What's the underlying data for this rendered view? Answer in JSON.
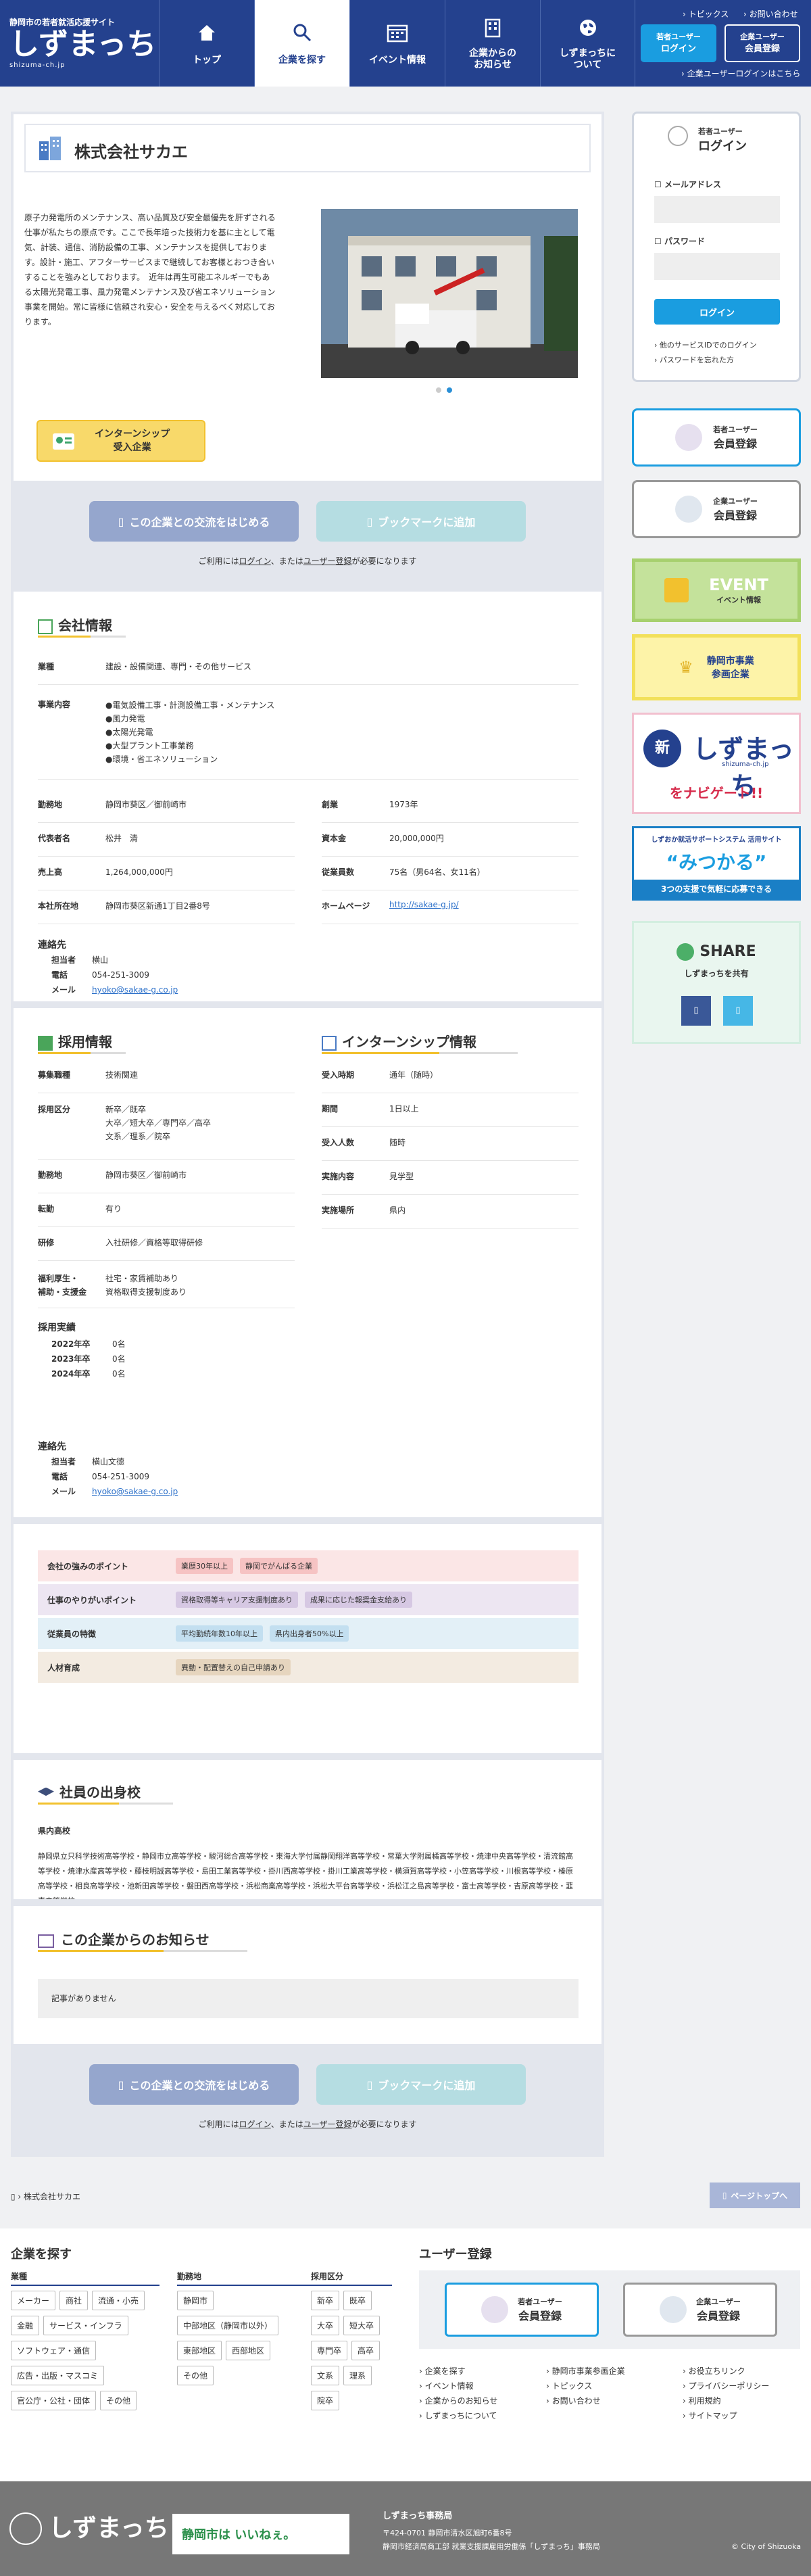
{
  "header": {
    "subtitle": "静岡市の若者就活応援サイト",
    "logo": "しずまっち",
    "logo_roman": "shizuma-ch.jp",
    "nav": [
      "トップ",
      "企業を探す",
      "イベント情報",
      "企業からの\nお知らせ",
      "しずまっちに\nついて"
    ],
    "top_links": [
      "トピックス",
      "お問い合わせ"
    ],
    "youth_login": "若者ユーザー",
    "youth_login2": "ログイン",
    "corp_reg": "企業ユーザー",
    "corp_reg2": "会員登録",
    "corp_login": "企業ユーザーログインはこちら"
  },
  "company": {
    "name": "株式会社サカエ",
    "description": "原子力発電所のメンテナンス、高い品質及び安全最優先を肝ずされる仕事が私たちの原点です。ここで長年培った技術力を基に主として電気、計装、通信、消防設備の工事、メンテナンスを提供しております。設計・施工、アフターサービスまで継続してお客様とおつき合いすることを強みとしております。　近年は再生可能エネルギーでもある太陽光発電工事、風力発電メンテナンス及び省エネソリューション事業を開始。常に皆様に信頼され安心・安全を与えるべく対応しております。",
    "badge": "インターンシップ\n受入企業",
    "btn_exchange": "この企業との交流をはじめる",
    "btn_bookmark": "ブックマークに追加",
    "note_pre": "ご利用には",
    "note_login": "ログイン",
    "note_mid": "、または",
    "note_reg": "ユーザー登録",
    "note_post": "が必要になります"
  },
  "info": {
    "title": "会社情報",
    "industry_k": "業種",
    "industry_v": "建設・設備関連、専門・その他サービス",
    "business_k": "事業内容",
    "business_v": [
      "●電気設備工事・計測設備工事・メンテナンス",
      "●風力発電",
      "●太陽光発電",
      "●大型プラント工事業務",
      "●環境・省エネソリューション"
    ],
    "rows": [
      [
        "勤務地",
        "静岡市葵区／御前崎市",
        "創業",
        "1973年"
      ],
      [
        "代表者名",
        "松井　清",
        "資本金",
        "20,000,000円"
      ],
      [
        "売上高",
        "1,264,000,000円",
        "従業員数",
        "75名（男64名、女11名）"
      ],
      [
        "本社所在地",
        "静岡市葵区新通1丁目2番8号",
        "ホームページ",
        "http://sakae-g.jp/"
      ]
    ],
    "contact_title": "連絡先",
    "contact": [
      [
        "担当者",
        "横山"
      ],
      [
        "電話",
        "054-251-3009"
      ],
      [
        "メール",
        "hyoko@sakae-g.co.jp"
      ]
    ]
  },
  "recruit": {
    "title": "採用情報",
    "rows": [
      [
        "募集職種",
        "技術関連"
      ],
      [
        "採用区分",
        "新卒／既卒\n大卒／短大卒／専門卒／高卒\n文系／理系／院卒"
      ],
      [
        "勤務地",
        "静岡市葵区／御前崎市"
      ],
      [
        "転勤",
        "有り"
      ],
      [
        "研修",
        "入社研修／資格等取得研修"
      ],
      [
        "福利厚生・\n補助・支援金",
        "社宅・家賃補助あり\n資格取得支援制度あり"
      ]
    ],
    "results_title": "採用実績",
    "results": [
      [
        "2022年卒",
        "0名"
      ],
      [
        "2023年卒",
        "0名"
      ],
      [
        "2024年卒",
        "0名"
      ]
    ],
    "contact_title": "連絡先",
    "contact": [
      [
        "担当者",
        "横山文德"
      ],
      [
        "電話",
        "054-251-3009"
      ],
      [
        "メール",
        "hyoko@sakae-g.co.jp"
      ]
    ]
  },
  "intern": {
    "title": "インターンシップ情報",
    "rows": [
      [
        "受入時期",
        "通年（随時）"
      ],
      [
        "期間",
        "1日以上"
      ],
      [
        "受入人数",
        "随時"
      ],
      [
        "実施内容",
        "見学型"
      ],
      [
        "実施場所",
        "県内"
      ]
    ]
  },
  "points": [
    {
      "k": "会社の強みのポイント",
      "tags": [
        "業歴30年以上",
        "静岡でがんばる企業"
      ],
      "bg": "#fbe6e6",
      "tc": "#f6c3c3"
    },
    {
      "k": "仕事のやりがいポイント",
      "tags": [
        "資格取得等キャリア支援制度あり",
        "成果に応じた報奨金支給あり"
      ],
      "bg": "#ede6f2",
      "tc": "#d6c8e3"
    },
    {
      "k": "従業員の特徴",
      "tags": [
        "平均勤続年数10年以上",
        "県内出身者50%以上"
      ],
      "bg": "#e3f0f7",
      "tc": "#c3dff0"
    },
    {
      "k": "人材育成",
      "tags": [
        "異動・配置替えの自己申請あり"
      ],
      "bg": "#f3ebe1",
      "tc": "#e6d5be"
    }
  ],
  "schools": {
    "title": "社員の出身校",
    "sub": "県内高校",
    "text": "静岡県立只科学技術高等学校・静岡市立高等学校・駿河総合高等学校・東海大学付属静岡翔洋高等学校・常葉大学附属橘高等学校・焼津中央高等学校・清流館高等学校・焼津水産高等学校・藤枝明誠高等学校・島田工業高等学校・掛川西高等学校・掛川工業高等学校・横須賀高等学校・小笠高等学校・川根高等学校・榛原高等学校・相良高等学校・池新田高等学校・磐田西高等学校・浜松商業高等学校・浜松大平台高等学校・浜松江之島高等学校・富士高等学校・吉原高等学校・韮恵高等学校"
  },
  "notice": {
    "title": "この企業からのお知らせ",
    "empty": "記事がありません"
  },
  "breadcrumb": "株式会社サカエ",
  "pagetop": "ページトップへ",
  "side": {
    "login_title": "若者ユーザー",
    "login_title2": "ログイン",
    "mail": "メールアドレス",
    "pass": "パスワード",
    "login_btn": "ログイン",
    "other": "他のサービスIDでのログイン",
    "forgot": "パスワードを忘れた方",
    "youth_reg": "若者ユーザー",
    "youth_reg2": "会員登録",
    "corp_reg": "企業ユーザー",
    "corp_reg2": "会員登録",
    "event": "EVENT",
    "event_sub": "イベント情報",
    "city": "静岡市事業\n参画企業",
    "navi_logo": "しずまっち",
    "navi_sub": "shizuma-ch.jp",
    "navi": "をナビゲート!!",
    "support": "しずおか就活サポートシステム 活用サイト",
    "mitsukaru": "“みつかる”",
    "mitsukaru_sub": "3つの支援で気軽に応募できる",
    "share": "SHARE",
    "share_sub": "しずまっちを共有"
  },
  "footer": {
    "search_title": "企業を探す",
    "industry": "業種",
    "ind_items": [
      "メーカー",
      "商社",
      "流通・小売",
      "金融",
      "サービス・インフラ",
      "ソフトウェア・通信",
      "広告・出版・マスコミ",
      "官公庁・公社・団体",
      "その他"
    ],
    "location": "勤務地",
    "loc_items": [
      "静岡市",
      "中部地区（静岡市以外）",
      "東部地区",
      "西部地区",
      "その他"
    ],
    "kubun": "採用区分",
    "kubun_items": [
      "新卒",
      "既卒",
      "大卒",
      "短大卒",
      "専門卒",
      "高卒",
      "文系",
      "理系",
      "院卒"
    ],
    "reg_title": "ユーザー登録",
    "youth": "若者ユーザー",
    "youth2": "会員登録",
    "corp": "企業ユーザー",
    "corp2": "会員登録",
    "links1": [
      "企業を探す",
      "イベント情報",
      "企業からのお知らせ",
      "しずまっちについて"
    ],
    "links2": [
      "静岡市事業参画企業",
      "トピックス",
      "お問い合わせ"
    ],
    "links3": [
      "お役立ちリンク",
      "プライバシーポリシー",
      "利用規約",
      "サイトマップ"
    ],
    "office": "しずまっち事務局",
    "addr1": "〒424-0701 静岡市清水区旭町6番8号",
    "addr2": "静岡市経済局商工部 就業支援課雇用労働係「しずまっち」事務局",
    "copy": "© City of Shizuoka",
    "banner": "静岡市は いいねぇ。"
  }
}
